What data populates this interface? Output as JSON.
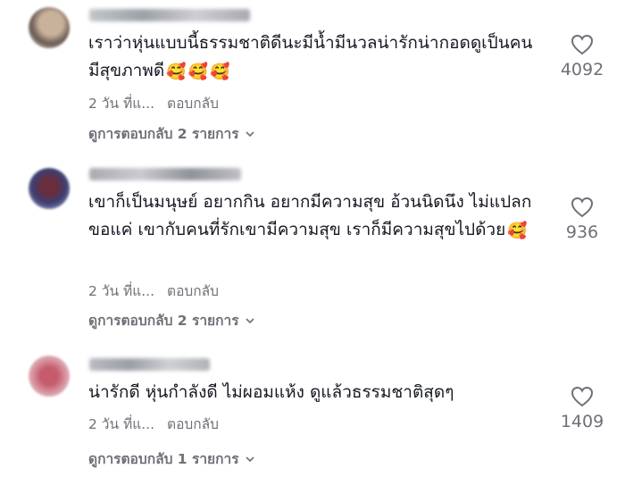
{
  "comments": [
    {
      "text": "เราว่าหุ่นแบบนี้ธรรมชาติดีนะมีน้ำมีนวลน่ารักน่ากอดดูเป็นคนมีสุขภาพดี",
      "emojis": [
        "🥰",
        "🥰",
        "🥰"
      ],
      "time": "2 วัน ที่แ...",
      "reply_label": "ตอบกลับ",
      "view_replies": "ดูการตอบกลับ 2 รายการ",
      "likes": "4092"
    },
    {
      "text": "เขาก็เป็นมนุษย์ อยากกิน อยากมีความสุข อ้วนนิดนึง ไม่แปลก ขอแค่ เขากับคนที่รักเขามีความสุข เราก็มีความสุขไปด้วย",
      "emojis": [
        "🥰"
      ],
      "time": "2 วัน ที่แ...",
      "reply_label": "ตอบกลับ",
      "view_replies": "ดูการตอบกลับ 2 รายการ",
      "likes": "936"
    },
    {
      "text": "น่ารักดี หุ่นกำลังดี ไม่ผอมแห้ง ดูแล้วธรรมชาติสุดๆ",
      "emojis": [],
      "time": "2 วัน ที่แ...",
      "reply_label": "ตอบกลับ",
      "view_replies": "ดูการตอบกลับ 1 รายการ",
      "likes": "1409"
    }
  ],
  "icons": {
    "like": "heart-outline-icon",
    "expand": "chevron-down-icon"
  },
  "colors": {
    "text": "#161823",
    "secondary": "#6f7078"
  }
}
